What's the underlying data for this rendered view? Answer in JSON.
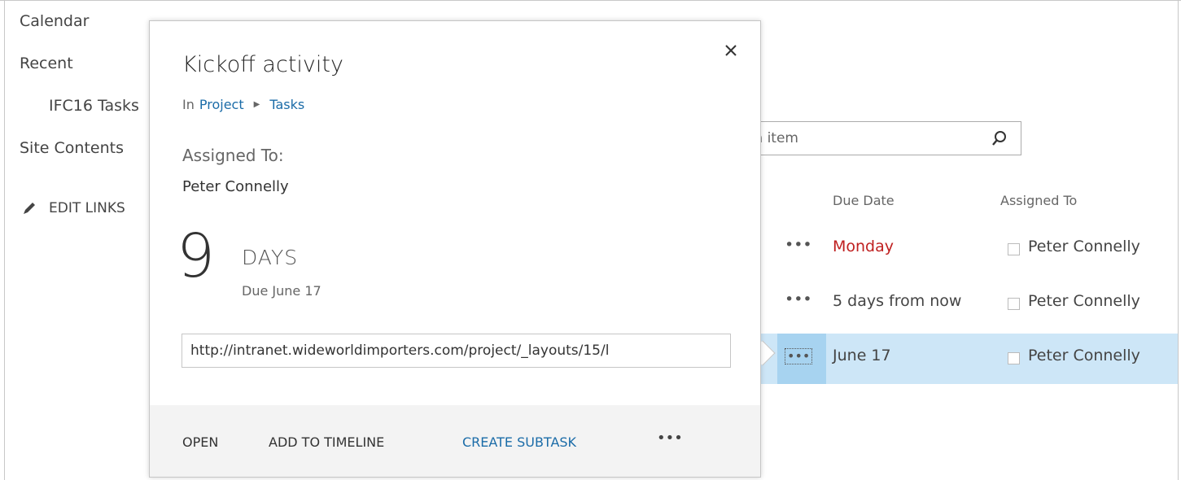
{
  "nav": {
    "items": [
      {
        "label": "Calendar"
      },
      {
        "label": "Recent"
      },
      {
        "label": "IFC16 Tasks"
      },
      {
        "label": "Site Contents"
      }
    ],
    "edit_links": "EDIT LINKS"
  },
  "search": {
    "placeholder": "nd an item"
  },
  "list": {
    "columns": {
      "due_date": "Due Date",
      "assigned_to": "Assigned To"
    },
    "rows": [
      {
        "due": "Monday",
        "assigned": "Peter Connelly",
        "overdue": true
      },
      {
        "due": "5 days from now",
        "assigned": "Peter Connelly",
        "overdue": false
      },
      {
        "due": "June 17",
        "assigned": "Peter Connelly",
        "overdue": false,
        "selected": true
      }
    ],
    "ellipsis": "•••"
  },
  "callout": {
    "title": "Kickoff activity",
    "breadcrumb": {
      "prefix": "In",
      "parent": "Project",
      "separator": "▶",
      "current": "Tasks"
    },
    "assigned_label": "Assigned To:",
    "assigned_name": "Peter Connelly",
    "days_number": "9",
    "days_label": "DAYS",
    "due_text": "Due June 17",
    "url": "http://intranet.wideworldimporters.com/project/_layouts/15/l",
    "actions": {
      "open": "OPEN",
      "add_to_timeline": "ADD TO TIMELINE",
      "create_subtask": "CREATE SUBTASK",
      "more": "•••"
    }
  },
  "colors": {
    "link": "#1b6ca8",
    "overdue": "#bf2020",
    "selected_row": "#cde6f7"
  }
}
